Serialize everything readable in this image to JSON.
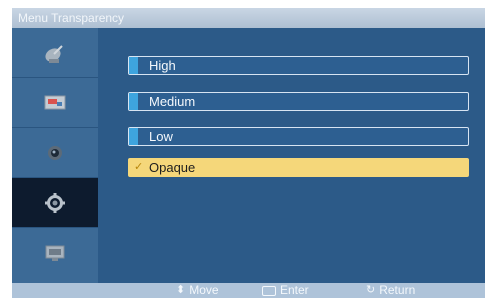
{
  "window": {
    "title": "Menu Transparency"
  },
  "sidebar": {
    "items": [
      {
        "icon": "satellite-dish-icon"
      },
      {
        "icon": "picture-icon"
      },
      {
        "icon": "sound-icon"
      },
      {
        "icon": "setup-gear-icon",
        "active": true
      },
      {
        "icon": "input-source-icon"
      }
    ]
  },
  "options": [
    {
      "label": "High",
      "selected": false
    },
    {
      "label": "Medium",
      "selected": false
    },
    {
      "label": "Low",
      "selected": false
    },
    {
      "label": "Opaque",
      "selected": true
    }
  ],
  "footer": {
    "move_label": "Move",
    "enter_label": "Enter",
    "return_label": "Return"
  },
  "colors": {
    "panel": "#2e5a86",
    "highlight": "#f5d77a",
    "accent": "#3ea4de"
  }
}
